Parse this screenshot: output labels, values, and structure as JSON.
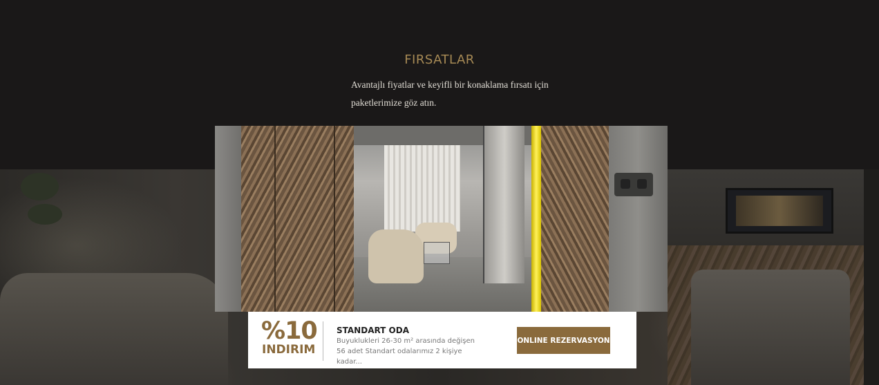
{
  "section": {
    "title": "FIRSATLAR",
    "description": "Avantajlı fiyatlar ve keyifli bir konaklama fırsatı için paketlerimize göz atın."
  },
  "offer": {
    "discount_value": "%10",
    "discount_label": "INDIRIM",
    "room_title": "STANDART ODA",
    "room_description": "Buyuklukleri 26-30 m² arasında değişen 56 adet Standart odalarımız 2 kişiye kadar...",
    "button_label": "ONLINE REZERVASYON"
  },
  "colors": {
    "accent": "#8a6a3c",
    "title_gold": "#a78a55",
    "dark_background": "#1a1818",
    "card_background": "#ffffff"
  }
}
